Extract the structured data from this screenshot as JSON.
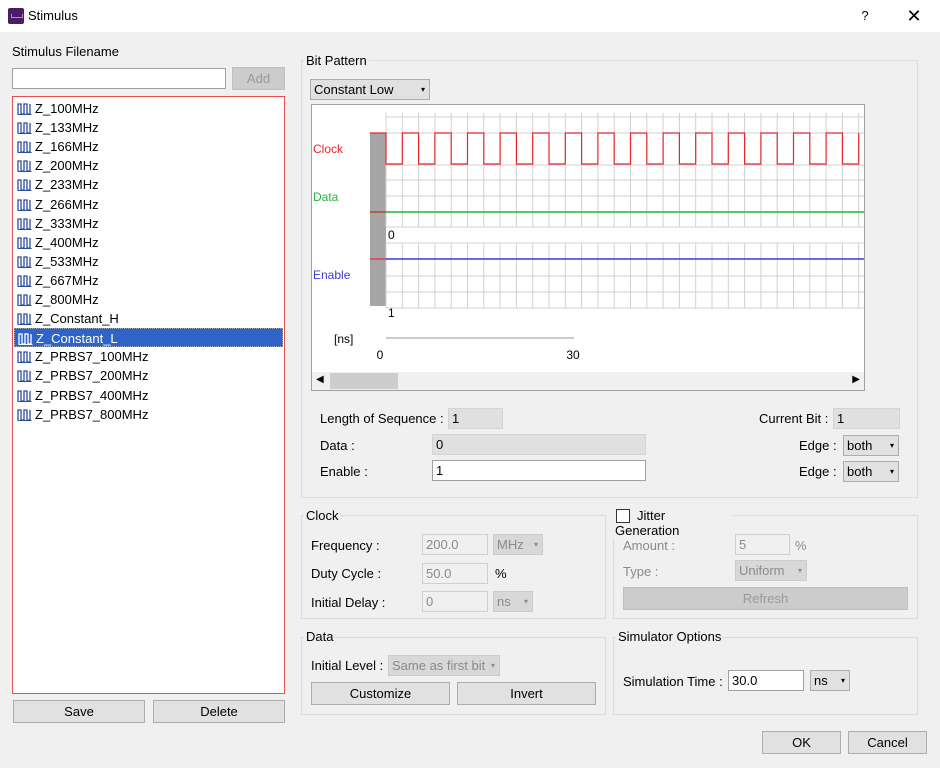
{
  "window": {
    "title": "Stimulus",
    "help": "?",
    "close": "✕"
  },
  "left": {
    "filename_label": "Stimulus Filename",
    "filename_value": "",
    "add_label": "Add",
    "items": [
      "Z_100MHz",
      "Z_133MHz",
      "Z_166MHz",
      "Z_200MHz",
      "Z_233MHz",
      "Z_266MHz",
      "Z_333MHz",
      "Z_400MHz",
      "Z_533MHz",
      "Z_667MHz",
      "Z_800MHz",
      "Z_Constant_H",
      "Z_Constant_L",
      "Z_PRBS7_100MHz",
      "Z_PRBS7_200MHz",
      "Z_PRBS7_400MHz",
      "Z_PRBS7_800MHz"
    ],
    "selected_index": 12,
    "save_label": "Save",
    "delete_label": "Delete"
  },
  "bit_pattern": {
    "title": "Bit Pattern",
    "pattern": "Constant Low",
    "wave": {
      "clock_label": "Clock",
      "data_label": "Data",
      "enable_label": "Enable",
      "data_bit": "0",
      "enable_bit": "1",
      "unit": "[ns]",
      "axis_start": "0",
      "axis_end": "30",
      "colors": {
        "clock": "#e8262a",
        "data": "#1fb93a",
        "enable": "#3a3adb"
      }
    },
    "length_label": "Length of Sequence :",
    "length_value": "1",
    "current_bit_label": "Current Bit :",
    "current_bit_value": "1",
    "data_label": "Data :",
    "data_value": "0",
    "enable_label": "Enable :",
    "enable_value": "1",
    "edge_label": "Edge :",
    "edge_data": "both",
    "edge_enable": "both"
  },
  "clock": {
    "title": "Clock",
    "frequency_label": "Frequency :",
    "frequency_value": "200.0",
    "frequency_unit": "MHz",
    "duty_label": "Duty Cycle :",
    "duty_value": "50.0",
    "duty_unit": "%",
    "delay_label": "Initial Delay :",
    "delay_value": "0",
    "delay_unit": "ns"
  },
  "jitter": {
    "title": "Jitter Generation",
    "amount_label": "Amount :",
    "amount_value": "5",
    "amount_unit": "%",
    "type_label": "Type :",
    "type_value": "Uniform",
    "refresh_label": "Refresh"
  },
  "data_group": {
    "title": "Data",
    "initial_level_label": "Initial Level :",
    "initial_level_value": "Same as first bit",
    "customize_label": "Customize",
    "invert_label": "Invert"
  },
  "simulator": {
    "title": "Simulator Options",
    "time_label": "Simulation Time :",
    "time_value": "30.0",
    "time_unit": "ns"
  },
  "footer": {
    "ok_label": "OK",
    "cancel_label": "Cancel"
  }
}
